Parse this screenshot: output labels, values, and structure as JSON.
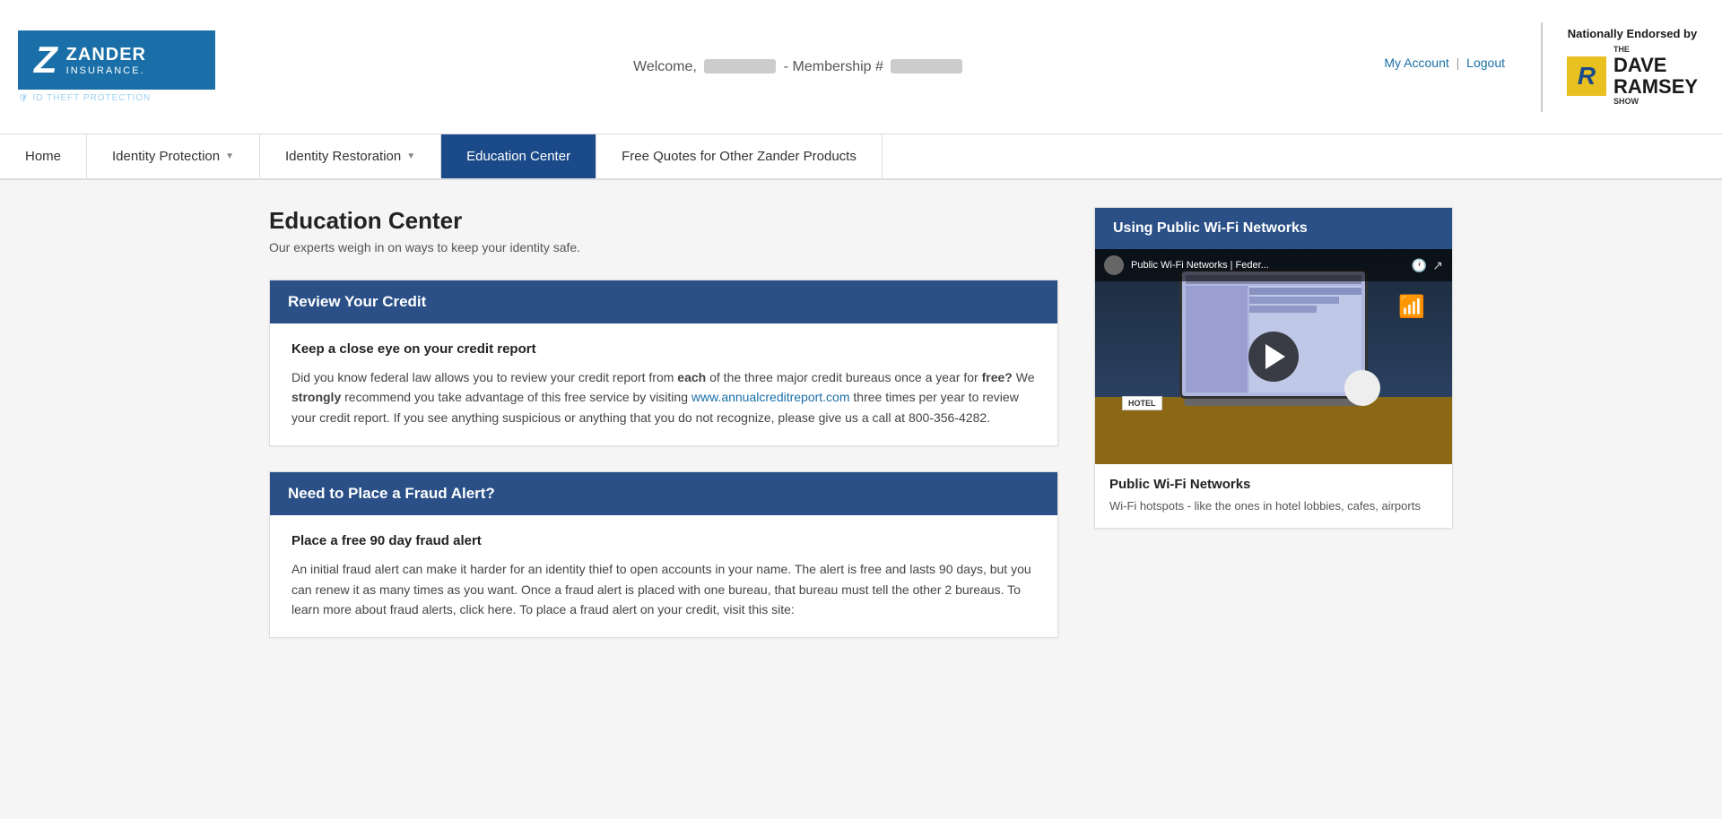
{
  "header": {
    "my_account_label": "My Account",
    "logout_label": "Logout",
    "welcome_text": "Welcome,",
    "membership_label": "Membership #",
    "nationally_endorsed": "Nationally Endorsed by",
    "dr_the": "THE",
    "dr_dave": "DAVE",
    "dr_ramsey": "RAMSEY",
    "dr_show": "SHOW",
    "logo_insurance": "Zander",
    "logo_sub": "INSURANCE.",
    "logo_tagline": "ID THEFT PROTECTION"
  },
  "nav": {
    "home": "Home",
    "identity_protection": "Identity Protection",
    "identity_restoration": "Identity Restoration",
    "education_center": "Education Center",
    "free_quotes": "Free Quotes for Other Zander Products"
  },
  "main": {
    "page_title": "Education Center",
    "page_subtitle": "Our experts weigh in on ways to keep your identity safe.",
    "card1": {
      "header": "Review Your Credit",
      "subheading": "Keep a close eye on your credit report",
      "body_before": "Did you know federal law allows you to review your credit report from ",
      "bold1": "each",
      "body_mid1": " of the three major credit bureaus once a year for ",
      "bold2": "free?",
      "body_mid2": " We ",
      "bold3": "strongly",
      "body_mid3": " recommend you take advantage of this free service by visiting ",
      "link_text": "www.annualcreditreport.com",
      "body_after": " three times per year to review your credit report. If you see anything suspicious or anything that you do not recognize, please give us a call at 800-356-4282."
    },
    "card2": {
      "header": "Need to Place a Fraud Alert?",
      "subheading": "Place a free 90 day fraud alert",
      "body": "An initial fraud alert can make it harder for an identity thief to open accounts in your name. The alert is free and lasts 90 days, but you can renew it as many times as you want. Once a fraud alert is placed with one bureau, that bureau must tell the other 2 bureaus. To learn more about fraud alerts, click here. To place a fraud alert on your credit, visit this site:"
    }
  },
  "sidebar": {
    "video_header": "Using Public Wi-Fi Networks",
    "video_title_bar": "Public Wi-Fi Networks | Feder...",
    "video_info_title": "Public Wi-Fi Networks",
    "video_info_desc": "Wi-Fi hotspots - like the ones in hotel lobbies, cafes, airports"
  }
}
